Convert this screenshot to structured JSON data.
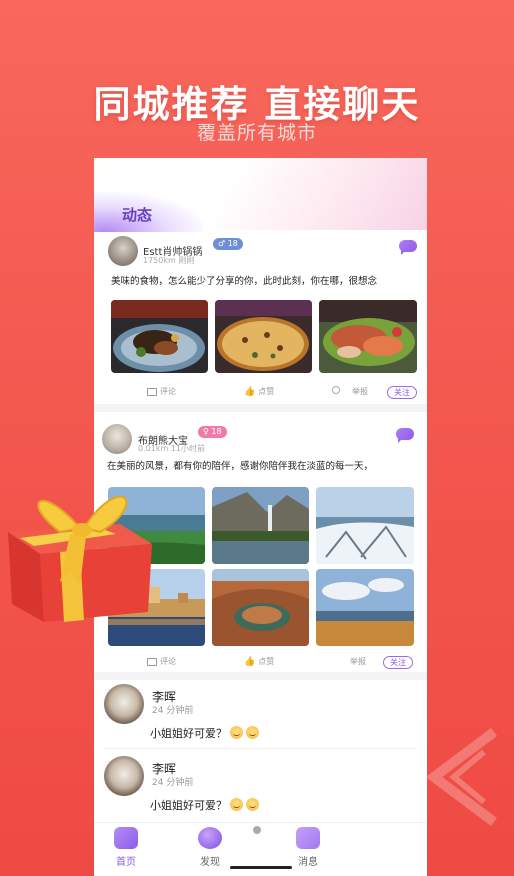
{
  "hero": {
    "title": "同城推荐  直接聊天",
    "subtitle": "覆盖所有城市"
  },
  "feed": {
    "tab_title": "动态",
    "posts": [
      {
        "username": "Estt肖帅锅锅",
        "distance": "1750km",
        "time": "刚刚",
        "badge": "18",
        "badge_color": "#6e8fd6",
        "text": "美味的食物，怎么能少了分享的你，此时此刻，你在哪，很想念",
        "images": [
          "steak-dish",
          "pizza",
          "seafood-platter"
        ],
        "actions": {
          "comment": "评论",
          "like": "点赞",
          "report": "举报",
          "follow": "关注"
        }
      },
      {
        "username": "布朗熊大宝",
        "distance": "0.01km",
        "time": "11小时前",
        "badge": "18",
        "badge_color": "#f07aa8",
        "text": "在美丽的风景，都有你的陪伴，感谢你陪伴我在淡蓝的每一天，",
        "images": [
          "lake-shore",
          "waterfall-valley",
          "snow-forest",
          "coastal-town",
          "canyon-bend",
          "autumn-lake"
        ],
        "actions": {
          "comment": "评论",
          "like": "点赞",
          "report": "举报",
          "follow": "关注"
        }
      }
    ],
    "comments": [
      {
        "name": "李晖",
        "time": "24 分钟前",
        "text": "小姐姐好可爱？"
      },
      {
        "name": "李晖",
        "time": "24 分钟前",
        "text": "小姐姐好可爱？"
      }
    ]
  },
  "nav": {
    "home": "首页",
    "discover": "发现",
    "messages": "消息"
  },
  "colors": {
    "accent": "#8e5bea",
    "brand_red": "#f3584f"
  }
}
